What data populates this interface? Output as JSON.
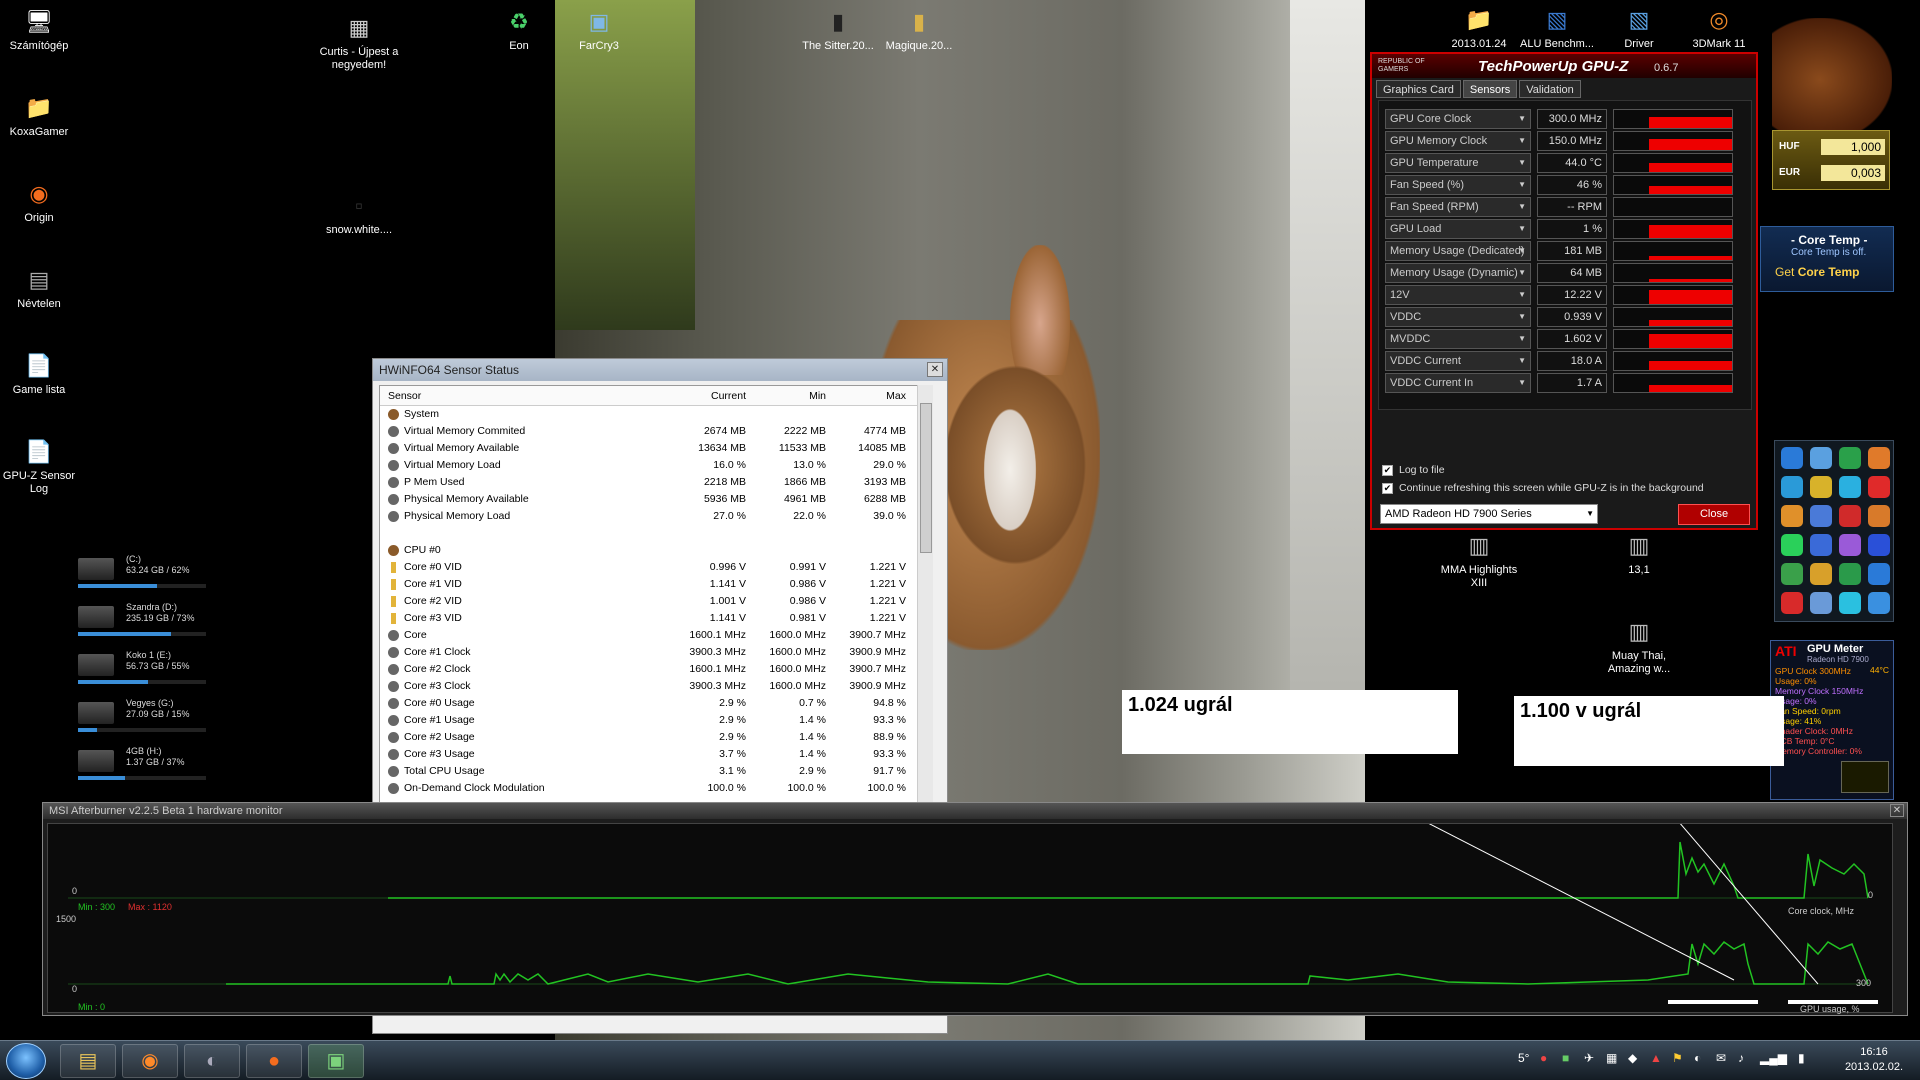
{
  "desktop_icons": [
    {
      "label": "Számítógép",
      "glyph": "🖥"
    },
    {
      "label": "KoxaGamer",
      "glyph": "📁"
    },
    {
      "label": "Origin",
      "glyph": "◉"
    },
    {
      "label": "Névtelen",
      "glyph": "▤"
    },
    {
      "label": "Game lista",
      "glyph": "📄"
    },
    {
      "label": "GPU-Z Sensor Log",
      "glyph": "📄"
    },
    {
      "label": "Curtis - Újpest a negyedem!",
      "glyph": "▦"
    },
    {
      "label": "snow.white....",
      "glyph": "▫"
    },
    {
      "label": "Eon",
      "glyph": "♻"
    },
    {
      "label": "FarCry3",
      "glyph": "▣"
    },
    {
      "label": "The Sitter.20...",
      "glyph": "▮"
    },
    {
      "label": "Magique.20...",
      "glyph": "▮"
    },
    {
      "label": "2013.01.24",
      "glyph": "📁"
    },
    {
      "label": "ALU Benchm...",
      "glyph": "▧"
    },
    {
      "label": "Driver",
      "glyph": "▧"
    },
    {
      "label": "3DMark 11",
      "glyph": "◎"
    },
    {
      "label": "MMA Highlights XIII",
      "glyph": "▥"
    },
    {
      "label": "13,1",
      "glyph": "▥"
    },
    {
      "label": "Muay Thai, Amazing w...",
      "glyph": "▥"
    }
  ],
  "drives": [
    {
      "name": "(C:)",
      "info": "63.24 GB / 62%",
      "pct": 62
    },
    {
      "name": "Szandra (D:)",
      "info": "235.19 GB / 73%",
      "pct": 73
    },
    {
      "name": "Koko 1 (E:)",
      "info": "56.73 GB / 55%",
      "pct": 55
    },
    {
      "name": "Vegyes (G:)",
      "info": "27.09 GB / 15%",
      "pct": 15
    },
    {
      "name": "4GB (H:)",
      "info": "1.37 GB / 37%",
      "pct": 37
    }
  ],
  "hwinfo": {
    "title": "HWiNFO64 Sensor Status",
    "close_glyph": "✕",
    "columns": [
      "Sensor",
      "Current",
      "Min",
      "Max"
    ],
    "rows": [
      {
        "type": "group",
        "name": "System",
        "cur": "",
        "min": "",
        "max": ""
      },
      {
        "type": "item",
        "name": "Virtual Memory Commited",
        "cur": "2674 MB",
        "min": "2222 MB",
        "max": "4774 MB"
      },
      {
        "type": "item",
        "name": "Virtual Memory Available",
        "cur": "13634 MB",
        "min": "11533 MB",
        "max": "14085 MB"
      },
      {
        "type": "item",
        "name": "Virtual Memory Load",
        "cur": "16.0 %",
        "min": "13.0 %",
        "max": "29.0 %"
      },
      {
        "type": "item",
        "name": "P Mem Used",
        "cur": "2218 MB",
        "min": "1866 MB",
        "max": "3193 MB"
      },
      {
        "type": "item",
        "name": "Physical Memory Available",
        "cur": "5936 MB",
        "min": "4961 MB",
        "max": "6288 MB"
      },
      {
        "type": "item",
        "name": "Physical Memory Load",
        "cur": "27.0 %",
        "min": "22.0 %",
        "max": "39.0 %"
      },
      {
        "type": "blank",
        "name": "",
        "cur": "",
        "min": "",
        "max": ""
      },
      {
        "type": "group",
        "name": "CPU #0",
        "cur": "",
        "min": "",
        "max": ""
      },
      {
        "type": "volt",
        "name": "Core #0 VID",
        "cur": "0.996 V",
        "min": "0.991 V",
        "max": "1.221 V"
      },
      {
        "type": "volt",
        "name": "Core #1 VID",
        "cur": "1.141 V",
        "min": "0.986 V",
        "max": "1.221 V"
      },
      {
        "type": "volt",
        "name": "Core #2 VID",
        "cur": "1.001 V",
        "min": "0.986 V",
        "max": "1.221 V"
      },
      {
        "type": "volt",
        "name": "Core #3 VID",
        "cur": "1.141 V",
        "min": "0.981 V",
        "max": "1.221 V"
      },
      {
        "type": "item",
        "name": "Core",
        "cur": "1600.1 MHz",
        "min": "1600.0 MHz",
        "max": "3900.7 MHz"
      },
      {
        "type": "item",
        "name": "Core #1 Clock",
        "cur": "3900.3 MHz",
        "min": "1600.0 MHz",
        "max": "3900.9 MHz"
      },
      {
        "type": "item",
        "name": "Core #2 Clock",
        "cur": "1600.1 MHz",
        "min": "1600.0 MHz",
        "max": "3900.7 MHz"
      },
      {
        "type": "item",
        "name": "Core #3 Clock",
        "cur": "3900.3 MHz",
        "min": "1600.0 MHz",
        "max": "3900.9 MHz"
      },
      {
        "type": "item",
        "name": "Core #0 Usage",
        "cur": "2.9 %",
        "min": "0.7 %",
        "max": "94.8 %"
      },
      {
        "type": "item",
        "name": "Core #1 Usage",
        "cur": "2.9 %",
        "min": "1.4 %",
        "max": "93.3 %"
      },
      {
        "type": "item",
        "name": "Core #2 Usage",
        "cur": "2.9 %",
        "min": "1.4 %",
        "max": "88.9 %"
      },
      {
        "type": "item",
        "name": "Core #3 Usage",
        "cur": "3.7 %",
        "min": "1.4 %",
        "max": "93.3 %"
      },
      {
        "type": "item",
        "name": "Total CPU Usage",
        "cur": "3.1 %",
        "min": "2.9 %",
        "max": "91.7 %"
      },
      {
        "type": "item",
        "name": "On-Demand Clock Modulation",
        "cur": "100.0 %",
        "min": "100.0 %",
        "max": "100.0 %"
      }
    ]
  },
  "gpuz": {
    "brand": "REPUBLIC OF GAMERS",
    "title": "TechPowerUp GPU-Z",
    "version": "0.6.7",
    "tabs": [
      "Graphics Card",
      "Sensors",
      "Validation"
    ],
    "active_tab": "Sensors",
    "sensors": [
      {
        "name": "GPU Core Clock",
        "value": "300.0 MHz",
        "level": 0.6
      },
      {
        "name": "GPU Memory Clock",
        "value": "150.0 MHz",
        "level": 0.6
      },
      {
        "name": "GPU Temperature",
        "value": "44.0 °C",
        "level": 0.5
      },
      {
        "name": "Fan Speed (%)",
        "value": "46 %",
        "level": 0.45
      },
      {
        "name": "Fan Speed (RPM)",
        "value": "-- RPM",
        "level": 0
      },
      {
        "name": "GPU Load",
        "value": "1 %",
        "level": 0.7
      },
      {
        "name": "Memory Usage (Dedicated)",
        "value": "181 MB",
        "level": 0.2
      },
      {
        "name": "Memory Usage (Dynamic)",
        "value": "64 MB",
        "level": 0.15
      },
      {
        "name": "12V",
        "value": "12.22 V",
        "level": 0.75
      },
      {
        "name": "VDDC",
        "value": "0.939 V",
        "level": 0.35
      },
      {
        "name": "MVDDC",
        "value": "1.602 V",
        "level": 0.8
      },
      {
        "name": "VDDC Current",
        "value": "18.0 A",
        "level": 0.5
      },
      {
        "name": "VDDC Current In",
        "value": "1.7 A",
        "level": 0.4
      }
    ],
    "log_to_file": "Log to file",
    "keep_refreshing": "Continue refreshing this screen while GPU-Z is in the background",
    "gpu_select": "AMD Radeon HD 7900 Series",
    "close_label": "Close"
  },
  "afterburner": {
    "title": "MSI Afterburner v2.2.5 Beta 1 hardware monitor",
    "close_glyph": "✕",
    "top_min": "Min : 300",
    "top_max": "Max : 1120",
    "top_scale_high": "1500",
    "top_scale_low": "0",
    "top_right_zero": "0",
    "top_label": "Core clock, MHz",
    "bottom_scale_low": "0",
    "bottom_value": "300",
    "bottom_label": "GPU usage, %",
    "bottom_min": "Min : 0"
  },
  "notes": {
    "left": "1.024 ugrál",
    "right": "1.100 v ugrál"
  },
  "currency": {
    "huf_label": "HUF",
    "huf_value": "1,000",
    "eur_label": "EUR",
    "eur_value": "0,003"
  },
  "coretemp": {
    "title": "- Core Temp -",
    "status": "Core Temp is off.",
    "get": "Get",
    "product": "Core Temp"
  },
  "gpumeter": {
    "logo": "ATI",
    "title": "GPU Meter",
    "model": "Radeon HD 7900",
    "lines": [
      "GPU Clock 300MHz",
      "Usage: 0%",
      "Memory Clock 150MHz",
      "Usage: 0%",
      "Fan Speed: 0rpm",
      "Usage: 41%",
      "Shader Clock: 0MHz",
      "PCB Temp: 0°C",
      "Memory Controller: 0%"
    ],
    "temp": "44°C"
  },
  "taskbar": {
    "weather": "5°",
    "time": "16:16",
    "date": "2013.02.02."
  }
}
